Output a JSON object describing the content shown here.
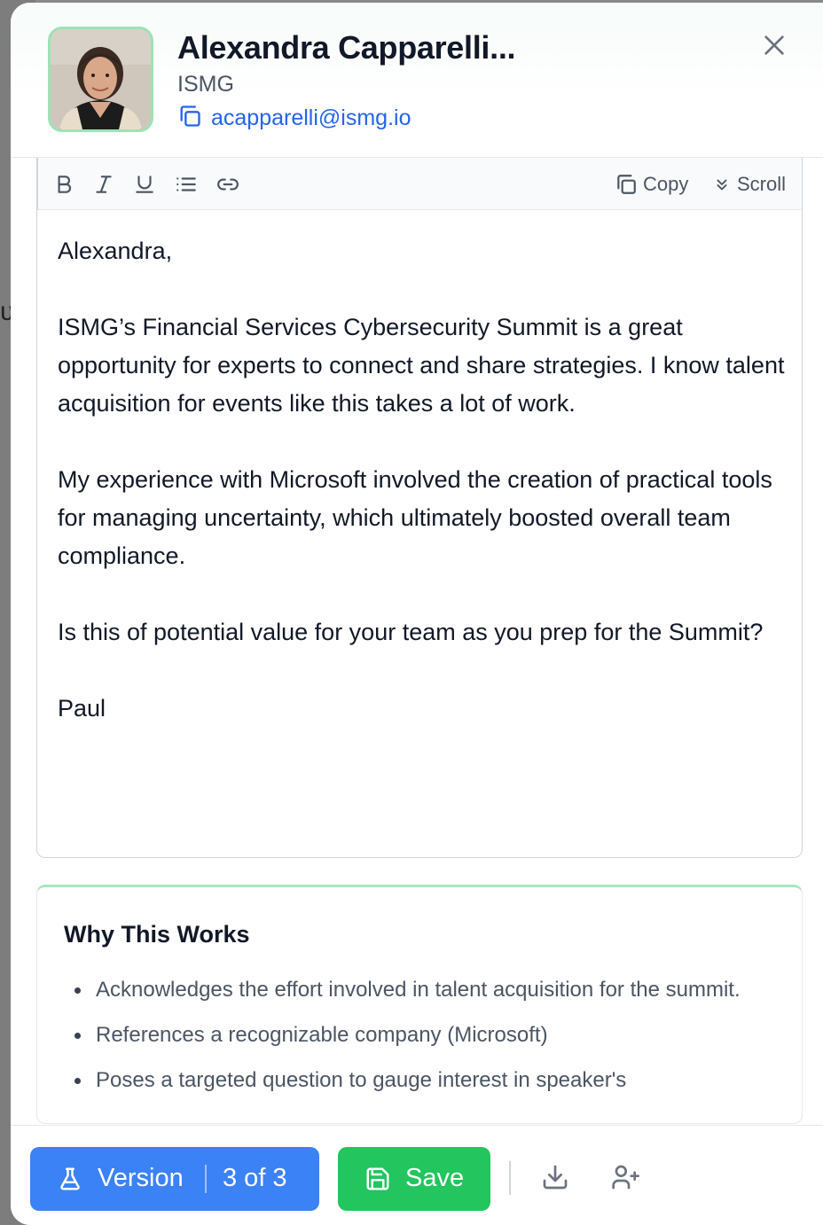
{
  "contact": {
    "name": "Alexandra Capparelli...",
    "company": "ISMG",
    "email": "acapparelli@ismg.io"
  },
  "icons": {
    "close": "close-icon",
    "copy_email": "copy-icon",
    "bold": "bold-icon",
    "italic": "italic-icon",
    "underline": "underline-icon",
    "list": "bullet-list-icon",
    "link": "link-icon",
    "copy": "copy-icon",
    "scroll": "chevrons-down-icon",
    "version": "flask-icon",
    "save": "floppy-disk-icon",
    "download": "download-icon",
    "add_user": "user-plus-icon"
  },
  "toolbar": {
    "copy_label": "Copy",
    "scroll_label": "Scroll"
  },
  "message": {
    "paragraphs": [
      "Alexandra,",
      "ISMG’s Financial Services Cybersecurity Summit is a great opportunity for experts to connect and share strategies. I know talent acquisition for events like this takes a lot of work.",
      "My experience with Microsoft involved the creation of practical tools for managing uncertainty, which ultimately boosted overall team compliance.",
      "Is this of potential value for your team as you prep for the Summit?",
      "Paul"
    ]
  },
  "why_this_works": {
    "title": "Why This Works",
    "items": [
      "Acknowledges the effort involved in talent acquisition for the summit.",
      "References a recognizable company (Microsoft)",
      "Poses a targeted question to gauge interest in speaker's"
    ]
  },
  "footer": {
    "version_label": "Version",
    "version_count": "3 of 3",
    "save_label": "Save"
  },
  "colors": {
    "accent_blue": "#3b82f6",
    "link_blue": "#2563eb",
    "save_green": "#22c55e",
    "avatar_border": "#9be3b4"
  }
}
